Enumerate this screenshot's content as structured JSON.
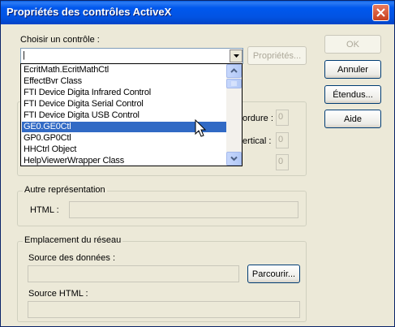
{
  "window": {
    "title": "Propriétés des contrôles ActiveX"
  },
  "choose": {
    "label": "Choisir un contrôle :",
    "value": "|"
  },
  "buttons": {
    "properties": "Propriétés...",
    "ok": "OK",
    "cancel": "Annuler",
    "extended": "Étendus...",
    "help": "Aide",
    "browse": "Parcourir..."
  },
  "dropdown": {
    "items": [
      "EcritMath.EcritMathCtl",
      "EffectBvr Class",
      "FTI Device Digita Infrared Control",
      "FTI Device Digita Serial Control",
      "FTI Device Digita USB Control",
      "GE0.GE0Ctl",
      "GP0.GP0Ctl",
      "HHCtrl Object",
      "HelpViewerWrapper Class"
    ],
    "selected_index": 5
  },
  "layout_fields": {
    "border_label": "ordure :",
    "border_value": "0",
    "vertical_label": "ertical :",
    "vertical_value": "0",
    "third_value": "0"
  },
  "alt": {
    "group": "Autre représentation",
    "html_label": "HTML :",
    "html_value": ""
  },
  "network": {
    "group": "Emplacement du réseau",
    "data_source_label": "Source des données :",
    "data_source_value": "",
    "source_html_label": "Source HTML :",
    "source_html_value": ""
  },
  "colors": {
    "titlebar": "#0058EE",
    "selection": "#316AC5",
    "dialog_bg": "#ECE9D8"
  }
}
